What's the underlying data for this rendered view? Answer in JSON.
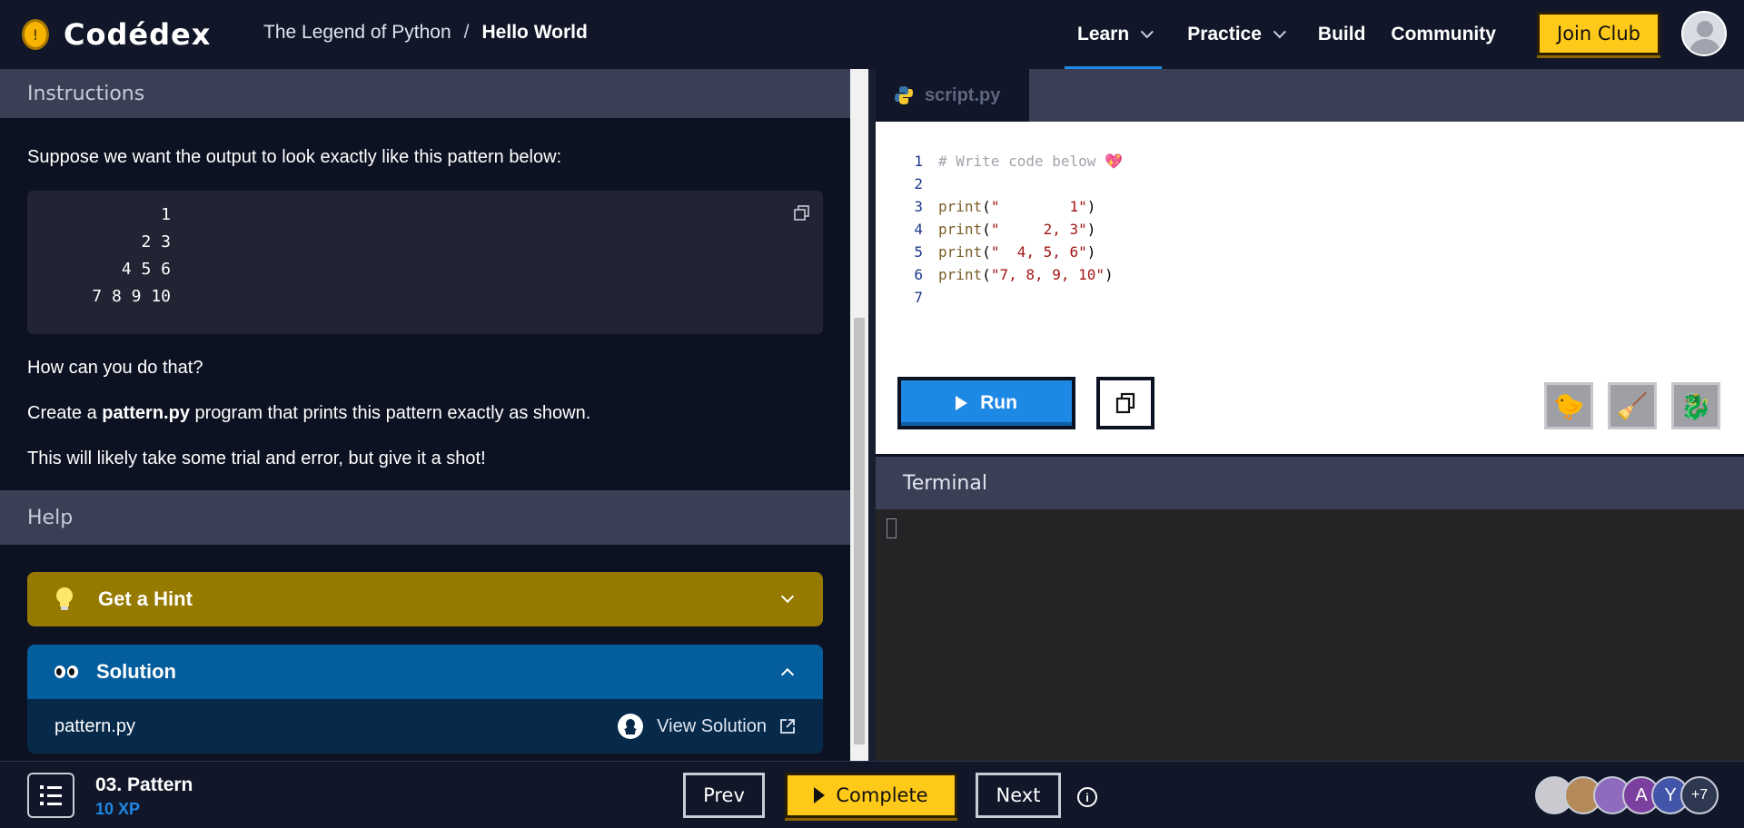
{
  "header": {
    "logo_text": "Codédex",
    "logo_coin": "!",
    "breadcrumb": {
      "course": "The Legend of Python",
      "separator": "/",
      "current": "Hello World"
    },
    "nav": [
      "Learn",
      "Practice",
      "Build",
      "Community"
    ],
    "join_label": "Join Club"
  },
  "instructions": {
    "heading": "Instructions",
    "intro": "Suppose we want the output to look exactly like this pattern below:",
    "pattern_lines": [
      "1",
      "2 3",
      "4 5 6",
      "7 8 9 10"
    ],
    "question": "How can you do that?",
    "task_pre": "Create a ",
    "task_file": "pattern.py",
    "task_post": " program that prints this pattern exactly as shown.",
    "note": "This will likely take some trial and error, but give it a shot!"
  },
  "help": {
    "heading": "Help",
    "hint_label": "Get a Hint",
    "solution_label": "Solution",
    "solution_file": "pattern.py",
    "view_solution": "View Solution"
  },
  "editor": {
    "tab_name": "script.py",
    "lines": [
      {
        "n": "1",
        "comment": "# Write code below ",
        "emoji": "💖"
      },
      {
        "n": "2"
      },
      {
        "n": "3",
        "fn": "print",
        "arg": "\"        1\""
      },
      {
        "n": "4",
        "fn": "print",
        "arg": "\"     2, 3\""
      },
      {
        "n": "5",
        "fn": "print",
        "arg": "\"  4, 5, 6\""
      },
      {
        "n": "6",
        "fn": "print",
        "arg": "\"7, 8, 9, 10\""
      },
      {
        "n": "7"
      }
    ],
    "run_label": "Run",
    "pets": [
      "🐤",
      "🧹",
      "🐉"
    ]
  },
  "terminal": {
    "heading": "Terminal"
  },
  "footer": {
    "lesson_title": "03. Pattern",
    "lesson_xp": "10 XP",
    "prev_label": "Prev",
    "complete_label": "Complete",
    "next_label": "Next",
    "info_glyph": "i",
    "avatars": [
      "",
      "",
      "",
      "A",
      "Y",
      "+7"
    ],
    "avatar_colors": [
      "#c9c9cf",
      "#b48a5a",
      "#8e6bbf",
      "#7b3fa0",
      "#4355a8",
      "#2e3850"
    ]
  }
}
